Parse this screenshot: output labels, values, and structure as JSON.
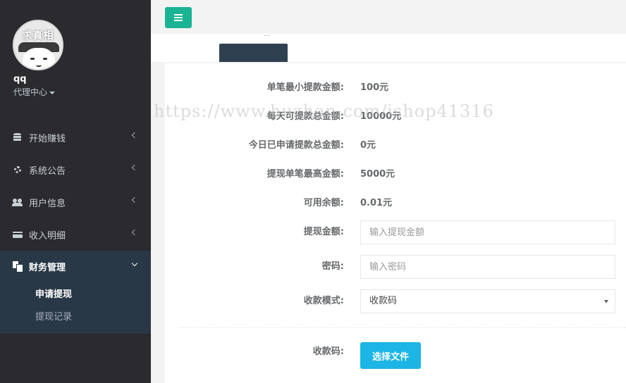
{
  "sidebar": {
    "avatar_text": "求真相",
    "username": "qq",
    "role": "代理中心",
    "items": [
      {
        "label": "开始赚钱",
        "icon": "database-icon"
      },
      {
        "label": "系统公告",
        "icon": "gear-icon"
      },
      {
        "label": "用户信息",
        "icon": "users-icon"
      },
      {
        "label": "收入明细",
        "icon": "credit-card-icon"
      },
      {
        "label": "财务管理",
        "icon": "copy-icon"
      }
    ],
    "sub_items": [
      {
        "label": "申请提现"
      },
      {
        "label": "提现记录"
      }
    ]
  },
  "header": {
    "menu_icon": "hamburger-icon",
    "tab_dots": "···"
  },
  "form": {
    "rows": [
      {
        "label": "单笔最小提款金额:",
        "value": "100元"
      },
      {
        "label": "每天可提款总金额:",
        "value": "10000元"
      },
      {
        "label": "今日已申请提款总金额:",
        "value": "0元"
      },
      {
        "label": "提现单笔最高金额:",
        "value": "5000元"
      },
      {
        "label": "可用余额:",
        "value": "0.01元"
      }
    ],
    "amount_label": "提现金额:",
    "amount_placeholder": "输入提现金额",
    "password_label": "密码:",
    "password_placeholder": "输入密码",
    "mode_label": "收款模式:",
    "mode_value": "收款码",
    "qrcode_label": "收款码:",
    "file_button": "选择文件"
  },
  "watermark": "https://www.huzhan.com/ishop41316",
  "colors": {
    "sidebar_bg": "#2b2a2e",
    "active_bg": "#293846",
    "menu_button": "#1ab394",
    "file_button": "#1cb5e5"
  }
}
